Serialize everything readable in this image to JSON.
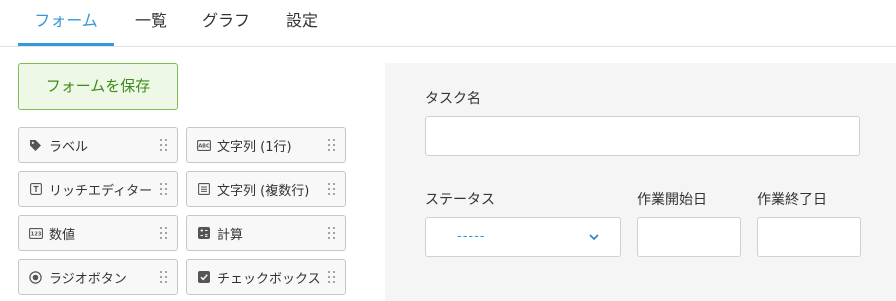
{
  "tabs": [
    {
      "label": "フォーム",
      "active": true
    },
    {
      "label": "一覧",
      "active": false
    },
    {
      "label": "グラフ",
      "active": false
    },
    {
      "label": "設定",
      "active": false
    }
  ],
  "toolbar": {
    "save_label": "フォームを保存"
  },
  "palette": {
    "items": [
      {
        "label": "ラベル",
        "icon": "tag-icon"
      },
      {
        "label": "文字列 (1行)",
        "icon": "text-field-icon"
      },
      {
        "label": "リッチエディター",
        "icon": "rich-text-icon"
      },
      {
        "label": "文字列 (複数行)",
        "icon": "multiline-text-icon"
      },
      {
        "label": "数値",
        "icon": "number-icon"
      },
      {
        "label": "計算",
        "icon": "calculator-icon"
      },
      {
        "label": "ラジオボタン",
        "icon": "radio-icon"
      },
      {
        "label": "チェックボックス",
        "icon": "checkbox-icon"
      }
    ]
  },
  "form": {
    "task_name_label": "タスク名",
    "task_name_value": "",
    "status_label": "ステータス",
    "status_value": "-----",
    "start_date_label": "作業開始日",
    "start_date_value": "",
    "end_date_label": "作業終了日",
    "end_date_value": ""
  },
  "colors": {
    "accent": "#3498db",
    "save_bg": "#eef8e7",
    "save_border": "#7ec050",
    "save_text": "#3f8a1c",
    "canvas_bg": "#f5f5f5"
  }
}
